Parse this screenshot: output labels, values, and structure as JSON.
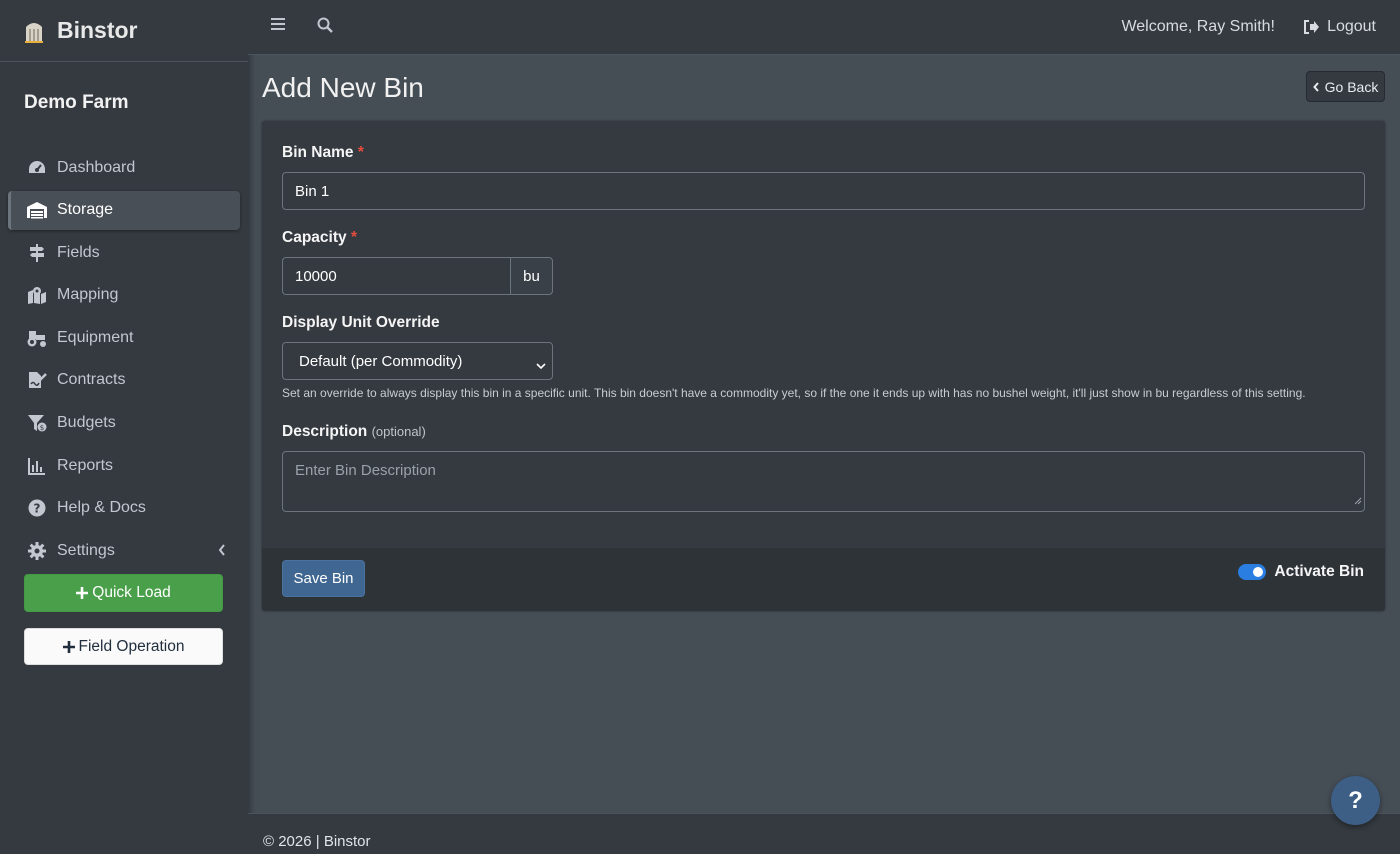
{
  "brand": {
    "name": "Binstor",
    "icon": "silo-logo-icon"
  },
  "farm_name": "Demo Farm",
  "sidebar": {
    "items": [
      {
        "label": "Dashboard",
        "icon": "tachometer-icon",
        "active": false
      },
      {
        "label": "Storage",
        "icon": "warehouse-icon",
        "active": true
      },
      {
        "label": "Fields",
        "icon": "signs-post-icon",
        "active": false
      },
      {
        "label": "Mapping",
        "icon": "map-location-icon",
        "active": false
      },
      {
        "label": "Equipment",
        "icon": "tractor-icon",
        "active": false
      },
      {
        "label": "Contracts",
        "icon": "file-signature-icon",
        "active": false
      },
      {
        "label": "Budgets",
        "icon": "funnel-dollar-icon",
        "active": false
      },
      {
        "label": "Reports",
        "icon": "chart-bar-icon",
        "active": false
      },
      {
        "label": "Help & Docs",
        "icon": "question-circle-icon",
        "active": false
      },
      {
        "label": "Settings",
        "icon": "gear-icon",
        "active": false,
        "expandable": true
      }
    ],
    "quick_load": "Quick Load",
    "field_operation": "Field Operation"
  },
  "topbar": {
    "welcome": "Welcome, Ray Smith!",
    "logout": "Logout"
  },
  "page": {
    "title": "Add New Bin",
    "go_back": "Go Back"
  },
  "form": {
    "bin_name": {
      "label": "Bin Name",
      "required_mark": "*",
      "value": "Bin 1"
    },
    "capacity": {
      "label": "Capacity",
      "required_mark": "*",
      "value": "10000",
      "unit": "bu"
    },
    "display_unit": {
      "label": "Display Unit Override",
      "selected": "Default (per Commodity)",
      "help": "Set an override to always display this bin in a specific unit. This bin doesn't have a commodity yet, so if the one it ends up with has no bushel weight, it'll just show in bu regardless of this setting."
    },
    "description": {
      "label": "Description",
      "optional": "(optional)",
      "placeholder": "Enter Bin Description",
      "value": ""
    },
    "save": "Save Bin",
    "activate": {
      "label": "Activate Bin",
      "checked": true
    }
  },
  "footer": {
    "text": "© 2026 | Binstor"
  },
  "help_button": "?",
  "colors": {
    "sidebar_bg": "#343a40",
    "content_bg": "#454d55",
    "primary": "#3f6791",
    "success": "#4aa04a",
    "toggle_on": "#2a7de1",
    "required": "#e74c3c"
  }
}
